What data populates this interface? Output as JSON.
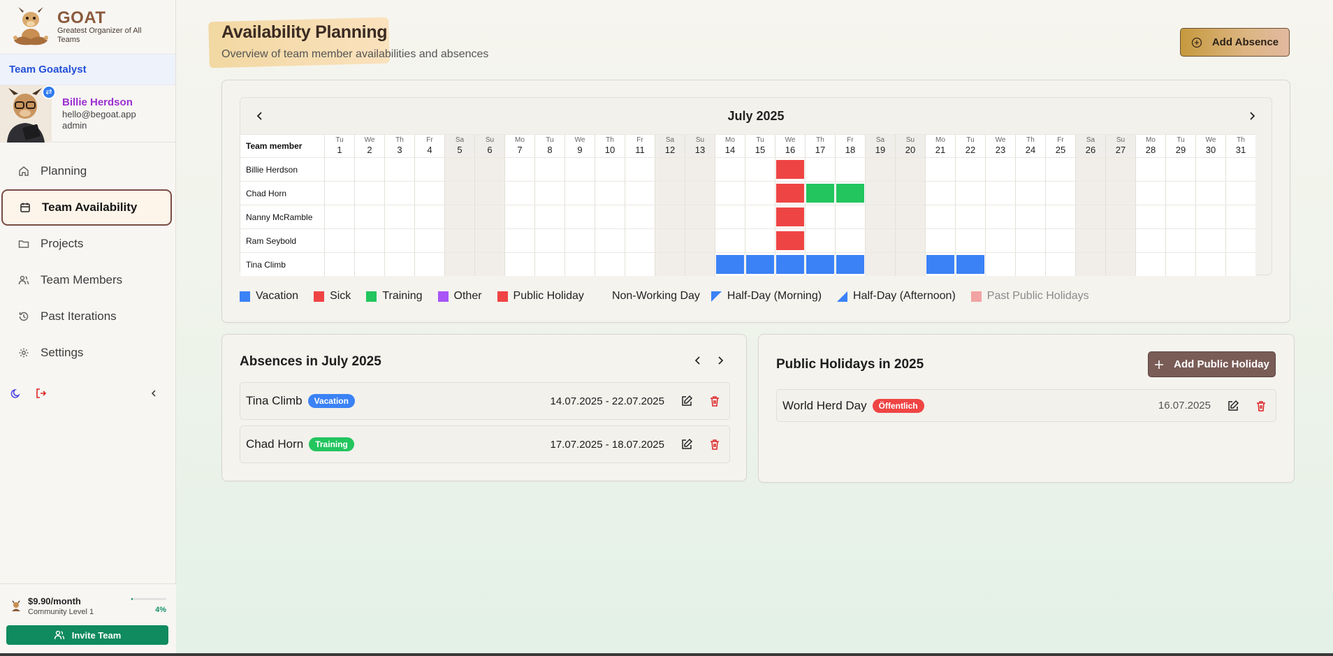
{
  "app": {
    "logo_title": "GOAT",
    "logo_subtitle": "Greatest Organizer of All Teams",
    "team_name": "Team Goatalyst"
  },
  "user": {
    "name": "Billie Herdson",
    "email": "hello@begoat.app",
    "role": "admin"
  },
  "nav": [
    {
      "label": "Planning",
      "icon": "home-icon",
      "active": false
    },
    {
      "label": "Team Availability",
      "icon": "calendar-icon",
      "active": true
    },
    {
      "label": "Projects",
      "icon": "folder-icon",
      "active": false
    },
    {
      "label": "Team Members",
      "icon": "users-icon",
      "active": false
    },
    {
      "label": "Past Iterations",
      "icon": "history-icon",
      "active": false
    },
    {
      "label": "Settings",
      "icon": "gear-icon",
      "active": false
    }
  ],
  "plan": {
    "price": "$9.90/month",
    "level": "Community Level 1",
    "progress_percent": 4,
    "progress_label": "4%",
    "invite_label": "Invite Team"
  },
  "page": {
    "title": "Availability Planning",
    "subtitle": "Overview of team member availabilities and absences",
    "add_absence_label": "Add Absence"
  },
  "calendar": {
    "month_label": "July 2025",
    "member_header": "Team member",
    "days": [
      {
        "wd": "Tu",
        "d": "1"
      },
      {
        "wd": "We",
        "d": "2"
      },
      {
        "wd": "Th",
        "d": "3"
      },
      {
        "wd": "Fr",
        "d": "4"
      },
      {
        "wd": "Sa",
        "d": "5"
      },
      {
        "wd": "Su",
        "d": "6"
      },
      {
        "wd": "Mo",
        "d": "7"
      },
      {
        "wd": "Tu",
        "d": "8"
      },
      {
        "wd": "We",
        "d": "9"
      },
      {
        "wd": "Th",
        "d": "10"
      },
      {
        "wd": "Fr",
        "d": "11"
      },
      {
        "wd": "Sa",
        "d": "12"
      },
      {
        "wd": "Su",
        "d": "13"
      },
      {
        "wd": "Mo",
        "d": "14"
      },
      {
        "wd": "Tu",
        "d": "15"
      },
      {
        "wd": "We",
        "d": "16"
      },
      {
        "wd": "Th",
        "d": "17"
      },
      {
        "wd": "Fr",
        "d": "18"
      },
      {
        "wd": "Sa",
        "d": "19"
      },
      {
        "wd": "Su",
        "d": "20"
      },
      {
        "wd": "Mo",
        "d": "21"
      },
      {
        "wd": "Tu",
        "d": "22"
      },
      {
        "wd": "We",
        "d": "23"
      },
      {
        "wd": "Th",
        "d": "24"
      },
      {
        "wd": "Fr",
        "d": "25"
      },
      {
        "wd": "Sa",
        "d": "26"
      },
      {
        "wd": "Su",
        "d": "27"
      },
      {
        "wd": "Mo",
        "d": "28"
      },
      {
        "wd": "Tu",
        "d": "29"
      },
      {
        "wd": "We",
        "d": "30"
      },
      {
        "wd": "Th",
        "d": "31"
      }
    ],
    "members": [
      {
        "name": "Billie Herdson",
        "marks": {
          "16": "holiday"
        }
      },
      {
        "name": "Chad Horn",
        "marks": {
          "16": "holiday",
          "17": "training",
          "18": "training"
        }
      },
      {
        "name": "Nanny McRamble",
        "marks": {
          "16": "holiday"
        }
      },
      {
        "name": "Ram Seybold",
        "marks": {
          "16": "holiday"
        }
      },
      {
        "name": "Tina Climb",
        "marks": {
          "14": "vacation",
          "15": "vacation",
          "16": "vacation",
          "17": "vacation",
          "18": "vacation",
          "21": "vacation",
          "22": "vacation"
        }
      }
    ]
  },
  "colors": {
    "vacation": "#3b82f6",
    "sick": "#ef4444",
    "training": "#22c55e",
    "other": "#a855f7",
    "holiday": "#ef4444",
    "past_holiday": "#f2a3a3"
  },
  "legend": {
    "vacation": "Vacation",
    "sick": "Sick",
    "training": "Training",
    "other": "Other",
    "holiday": "Public Holiday",
    "non_working": "Non-Working Day",
    "half_morning": "Half-Day (Morning)",
    "half_afternoon": "Half-Day (Afternoon)",
    "past_holiday": "Past Public Holidays"
  },
  "absences": {
    "title": "Absences in July 2025",
    "items": [
      {
        "name": "Tina Climb",
        "type": "Vacation",
        "dates": "14.07.2025 - 22.07.2025"
      },
      {
        "name": "Chad Horn",
        "type": "Training",
        "dates": "17.07.2025 - 18.07.2025"
      }
    ]
  },
  "holidays": {
    "title": "Public Holidays in 2025",
    "add_label": "Add Public Holiday",
    "items": [
      {
        "name": "World Herd Day",
        "badge": "Öffentlich",
        "date": "16.07.2025"
      }
    ]
  }
}
